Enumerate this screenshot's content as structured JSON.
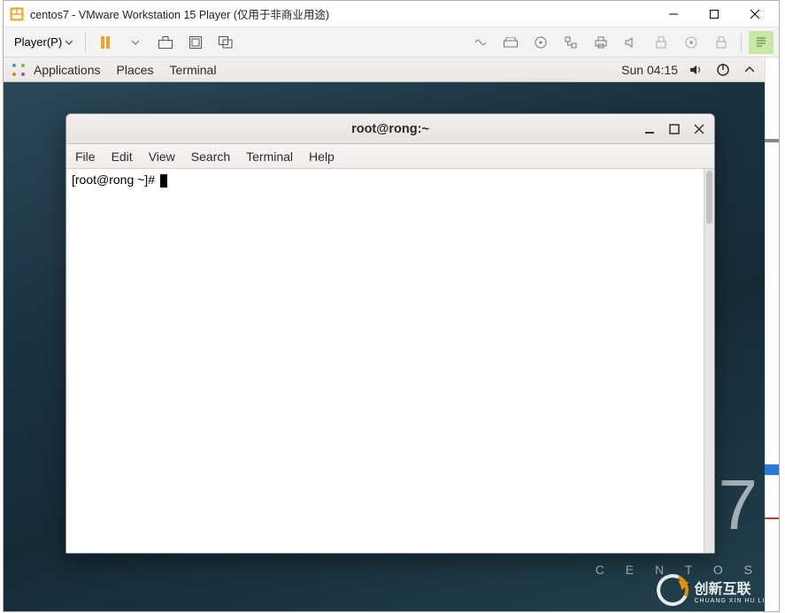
{
  "vmware": {
    "title": "centos7 - VMware Workstation 15 Player (仅用于非商业用途)",
    "player_menu": "Player(P)"
  },
  "gnome": {
    "menu": {
      "applications": "Applications",
      "places": "Places",
      "terminal": "Terminal"
    },
    "clock": "Sun 04:15"
  },
  "terminal": {
    "title": "root@rong:~",
    "menu": {
      "file": "File",
      "edit": "Edit",
      "view": "View",
      "search": "Search",
      "terminal": "Terminal",
      "help": "Help"
    },
    "prompt": "[root@rong ~]# "
  },
  "centos_wm": {
    "seven": "7",
    "word": "C E N T O S"
  },
  "brand": {
    "name": "创新互联",
    "sub": "CHUANG XIN HU LIAN"
  }
}
